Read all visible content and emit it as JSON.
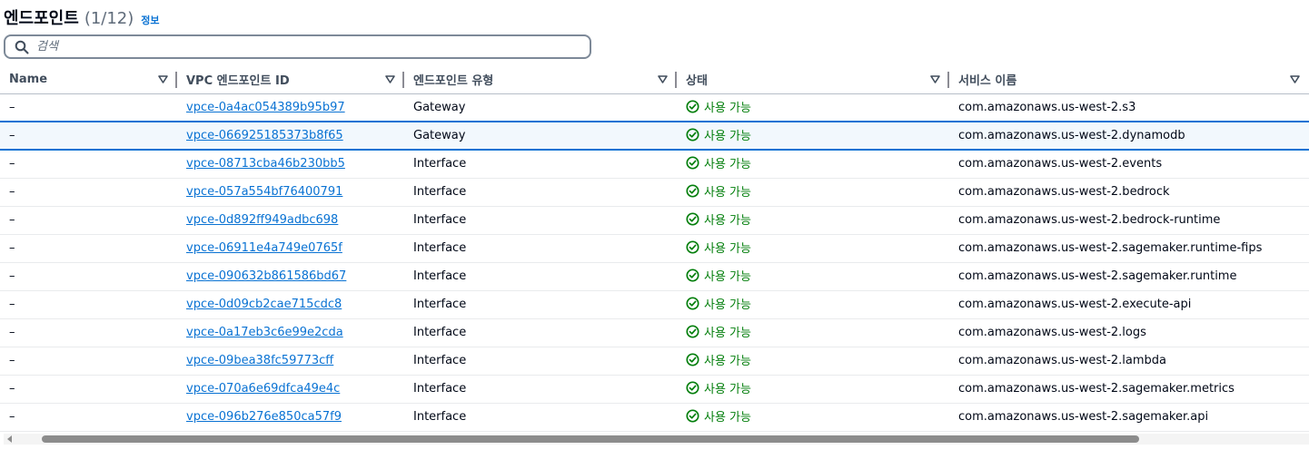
{
  "header": {
    "title": "엔드포인트",
    "count": "(1/12)",
    "info": "정보"
  },
  "search": {
    "placeholder": "검색"
  },
  "columns": [
    "Name",
    "VPC 엔드포인트 ID",
    "엔드포인트 유형",
    "상태",
    "서비스 이름"
  ],
  "status_color": "#037f0c",
  "link_color": "#0972d3",
  "rows": [
    {
      "name": "–",
      "id": "vpce-0a4ac054389b95b97",
      "type": "Gateway",
      "status": "사용 가능",
      "service": "com.amazonaws.us-west-2.s3",
      "selected": false
    },
    {
      "name": "–",
      "id": "vpce-066925185373b8f65",
      "type": "Gateway",
      "status": "사용 가능",
      "service": "com.amazonaws.us-west-2.dynamodb",
      "selected": true
    },
    {
      "name": "–",
      "id": "vpce-08713cba46b230bb5",
      "type": "Interface",
      "status": "사용 가능",
      "service": "com.amazonaws.us-west-2.events",
      "selected": false
    },
    {
      "name": "–",
      "id": "vpce-057a554bf76400791",
      "type": "Interface",
      "status": "사용 가능",
      "service": "com.amazonaws.us-west-2.bedrock",
      "selected": false
    },
    {
      "name": "–",
      "id": "vpce-0d892ff949adbc698",
      "type": "Interface",
      "status": "사용 가능",
      "service": "com.amazonaws.us-west-2.bedrock-runtime",
      "selected": false
    },
    {
      "name": "–",
      "id": "vpce-06911e4a749e0765f",
      "type": "Interface",
      "status": "사용 가능",
      "service": "com.amazonaws.us-west-2.sagemaker.runtime-fips",
      "selected": false
    },
    {
      "name": "–",
      "id": "vpce-090632b861586bd67",
      "type": "Interface",
      "status": "사용 가능",
      "service": "com.amazonaws.us-west-2.sagemaker.runtime",
      "selected": false
    },
    {
      "name": "–",
      "id": "vpce-0d09cb2cae715cdc8",
      "type": "Interface",
      "status": "사용 가능",
      "service": "com.amazonaws.us-west-2.execute-api",
      "selected": false
    },
    {
      "name": "–",
      "id": "vpce-0a17eb3c6e99e2cda",
      "type": "Interface",
      "status": "사용 가능",
      "service": "com.amazonaws.us-west-2.logs",
      "selected": false
    },
    {
      "name": "–",
      "id": "vpce-09bea38fc59773cff",
      "type": "Interface",
      "status": "사용 가능",
      "service": "com.amazonaws.us-west-2.lambda",
      "selected": false
    },
    {
      "name": "–",
      "id": "vpce-070a6e69dfca49e4c",
      "type": "Interface",
      "status": "사용 가능",
      "service": "com.amazonaws.us-west-2.sagemaker.metrics",
      "selected": false
    },
    {
      "name": "–",
      "id": "vpce-096b276e850ca57f9",
      "type": "Interface",
      "status": "사용 가능",
      "service": "com.amazonaws.us-west-2.sagemaker.api",
      "selected": false
    }
  ]
}
